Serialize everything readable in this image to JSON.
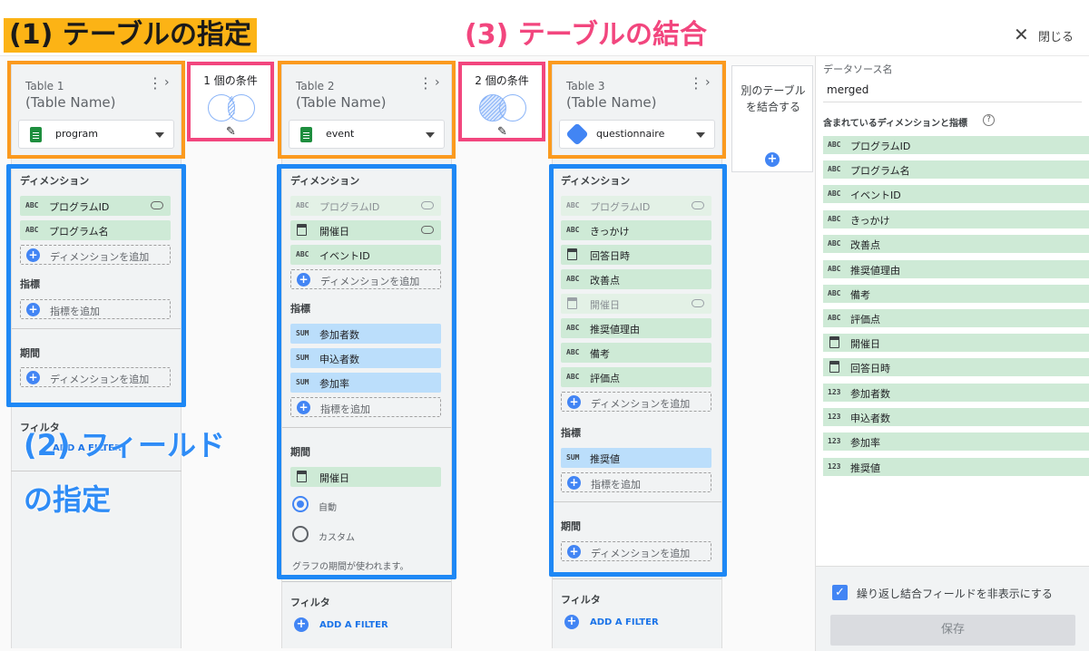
{
  "header": {
    "close_label": "閉じる"
  },
  "annotations": {
    "step1": "(1) テーブルの指定",
    "step2_line1": "(2) フィールド",
    "step2_line2": "の指定",
    "step3": "(3) テーブルの結合"
  },
  "tables": [
    {
      "title": "Table 1",
      "subtitle": "(Table Name)",
      "source": "program",
      "source_icon": "sheets-icon",
      "dimensions_title": "ディメンション",
      "dimensions": [
        {
          "type": "ABC",
          "label": "プログラムID",
          "linked": true,
          "dimmed": false
        },
        {
          "type": "ABC",
          "label": "プログラム名",
          "linked": false,
          "dimmed": false
        }
      ],
      "add_dimension": "ディメンションを追加",
      "metrics_title": "指標",
      "metrics": [],
      "add_metric": "指標を追加",
      "period_title": "期間",
      "period_add": "ディメンションを追加",
      "filter_title": "フィルタ",
      "filter_add": "ADD A FILTER"
    },
    {
      "title": "Table 2",
      "subtitle": "(Table Name)",
      "source": "event",
      "source_icon": "sheets-icon",
      "dimensions_title": "ディメンション",
      "dimensions": [
        {
          "type": "ABC",
          "label": "プログラムID",
          "linked": true,
          "dimmed": true
        },
        {
          "type": "DATE",
          "label": "開催日",
          "linked": true,
          "dimmed": false
        },
        {
          "type": "ABC",
          "label": "イベントID",
          "linked": false,
          "dimmed": false
        }
      ],
      "add_dimension": "ディメンションを追加",
      "metrics_title": "指標",
      "metrics": [
        {
          "type": "SUM",
          "label": "参加者数"
        },
        {
          "type": "SUM",
          "label": "申込者数"
        },
        {
          "type": "SUM",
          "label": "参加率"
        }
      ],
      "add_metric": "指標を追加",
      "period_title": "期間",
      "period_dimension": "開催日",
      "radio_auto": "自動",
      "radio_custom": "カスタム",
      "period_note": "グラフの期間が使われます。",
      "filter_title": "フィルタ",
      "filter_add": "ADD A FILTER"
    },
    {
      "title": "Table 3",
      "subtitle": "(Table Name)",
      "source": "questionnaire",
      "source_icon": "bigquery-icon",
      "dimensions_title": "ディメンション",
      "dimensions": [
        {
          "type": "ABC",
          "label": "プログラムID",
          "linked": true,
          "dimmed": true
        },
        {
          "type": "ABC",
          "label": "きっかけ",
          "linked": false,
          "dimmed": false
        },
        {
          "type": "DATE",
          "label": "回答日時",
          "linked": false,
          "dimmed": false
        },
        {
          "type": "ABC",
          "label": "改善点",
          "linked": false,
          "dimmed": false
        },
        {
          "type": "DATE",
          "label": "開催日",
          "linked": true,
          "dimmed": true
        },
        {
          "type": "ABC",
          "label": "推奨値理由",
          "linked": false,
          "dimmed": false
        },
        {
          "type": "ABC",
          "label": "備考",
          "linked": false,
          "dimmed": false
        },
        {
          "type": "ABC",
          "label": "評価点",
          "linked": false,
          "dimmed": false
        }
      ],
      "add_dimension": "ディメンションを追加",
      "metrics_title": "指標",
      "metrics": [
        {
          "type": "SUM",
          "label": "推奨値"
        }
      ],
      "add_metric": "指標を追加",
      "period_title": "期間",
      "period_add": "ディメンションを追加",
      "filter_title": "フィルタ",
      "filter_add": "ADD A FILTER"
    }
  ],
  "join_conditions": [
    {
      "label": "1 個の条件"
    },
    {
      "label": "2 個の条件"
    }
  ],
  "add_table": {
    "label": "別のテーブルを結合する"
  },
  "right_panel": {
    "source_name_label": "データソース名",
    "source_name_value": "merged",
    "fields_label": "含まれているディメンションと指標",
    "fields": [
      {
        "type": "ABC",
        "label": "プログラムID"
      },
      {
        "type": "ABC",
        "label": "プログラム名"
      },
      {
        "type": "ABC",
        "label": "イベントID"
      },
      {
        "type": "ABC",
        "label": "きっかけ"
      },
      {
        "type": "ABC",
        "label": "改善点"
      },
      {
        "type": "ABC",
        "label": "推奨値理由"
      },
      {
        "type": "ABC",
        "label": "備考"
      },
      {
        "type": "ABC",
        "label": "評価点"
      },
      {
        "type": "DATE",
        "label": "開催日"
      },
      {
        "type": "DATE",
        "label": "回答日時"
      },
      {
        "type": "123",
        "label": "参加者数"
      },
      {
        "type": "123",
        "label": "申込者数"
      },
      {
        "type": "123",
        "label": "参加率"
      },
      {
        "type": "123",
        "label": "推奨値"
      }
    ],
    "hide_repeated_label": "繰り返し結合フィールドを非表示にする",
    "hide_repeated_checked": true,
    "save_label": "保存"
  },
  "colors": {
    "dimension_chip": "#ceead6",
    "metric_chip": "#bbdefb",
    "accent_blue": "#4285f4",
    "annotation_orange": "#fb9a1e",
    "annotation_pink": "#f2467e",
    "annotation_blue": "#1e88f5"
  }
}
